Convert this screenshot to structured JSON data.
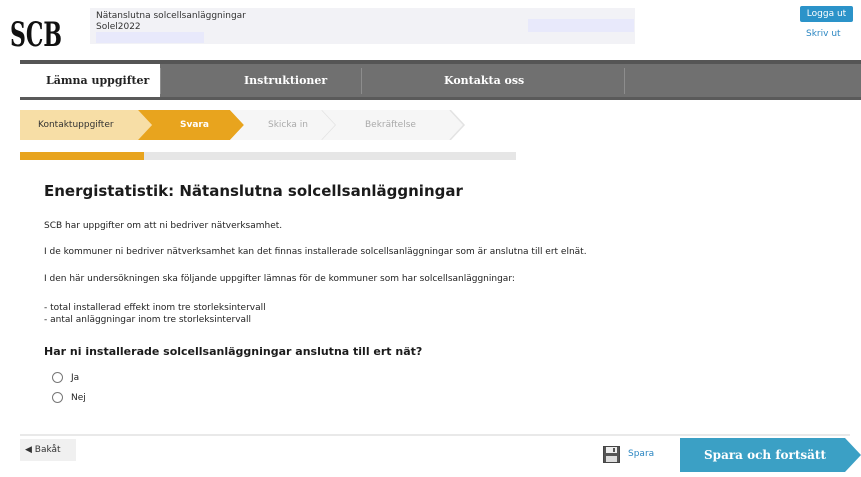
{
  "header": {
    "logo_text": "SCB",
    "survey_name": "Nätanslutna solcellsanläggningar",
    "survey_code": "Solel2022",
    "logout_label": "Logga ut",
    "print_label": "Skriv ut"
  },
  "nav": {
    "tabs": [
      {
        "label": "Lämna uppgifter",
        "active": true
      },
      {
        "label": "Instruktioner",
        "active": false
      },
      {
        "label": "Kontakta oss",
        "active": false
      }
    ]
  },
  "stepper": {
    "steps": [
      {
        "label": "Kontaktuppgifter",
        "state": "done"
      },
      {
        "label": "Svara",
        "state": "current"
      },
      {
        "label": "Skicka in",
        "state": "todo"
      },
      {
        "label": "Bekräftelse",
        "state": "todo"
      }
    ],
    "progress_fraction": 0.25
  },
  "content": {
    "title": "Energistatistik: Nätanslutna solcellsanläggningar",
    "paragraphs": [
      "SCB har uppgifter om att ni bedriver nätverksamhet.",
      "I de kommuner ni bedriver nätverksamhet kan det finnas installerade solcellsanläggningar som är anslutna till ert elnät.",
      "I den här undersökningen ska följande uppgifter lämnas för de kommuner som har solcellsanläggningar:",
      "- total installerad effekt inom tre storleksintervall",
      "- antal anläggningar inom tre storleksintervall"
    ],
    "question": "Har ni installerade solcellsanläggningar anslutna till ert nät?",
    "options": [
      "Ja",
      "Nej"
    ]
  },
  "footer": {
    "back_label": "◀ Bakåt",
    "save_label": "Spara",
    "next_label": "Spara och fortsätt"
  },
  "colors": {
    "accent_orange": "#e8a41e",
    "done_step": "#f7dea6",
    "nav_gray": "#707070",
    "teal_button": "#3ba0c5",
    "link_blue": "#2b86c2"
  },
  "icons": [
    "save-disk-icon",
    "back-arrow-icon"
  ]
}
